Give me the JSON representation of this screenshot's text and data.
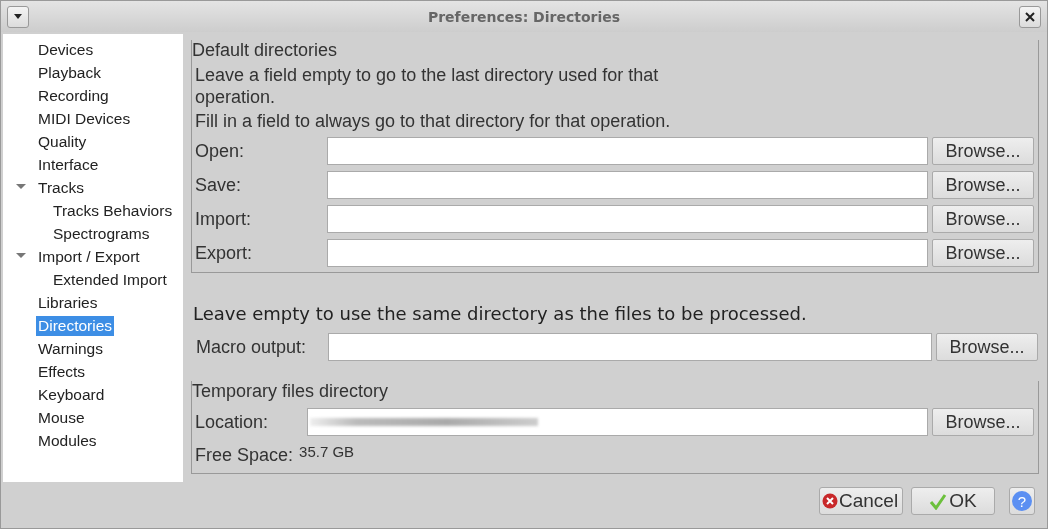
{
  "window": {
    "title": "Preferences: Directories"
  },
  "sidebar": {
    "items": [
      {
        "label": "Devices",
        "selected": false
      },
      {
        "label": "Playback",
        "selected": false
      },
      {
        "label": "Recording",
        "selected": false
      },
      {
        "label": "MIDI Devices",
        "selected": false
      },
      {
        "label": "Quality",
        "selected": false
      },
      {
        "label": "Interface",
        "selected": false
      },
      {
        "label": "Tracks",
        "selected": false,
        "expanded": true,
        "children": [
          {
            "label": "Tracks Behaviors",
            "selected": false
          },
          {
            "label": "Spectrograms",
            "selected": false
          }
        ]
      },
      {
        "label": "Import / Export",
        "selected": false,
        "expanded": true,
        "children": [
          {
            "label": "Extended Import",
            "selected": false
          }
        ]
      },
      {
        "label": "Libraries",
        "selected": false
      },
      {
        "label": "Directories",
        "selected": true
      },
      {
        "label": "Warnings",
        "selected": false
      },
      {
        "label": "Effects",
        "selected": false
      },
      {
        "label": "Keyboard",
        "selected": false
      },
      {
        "label": "Mouse",
        "selected": false
      },
      {
        "label": "Modules",
        "selected": false
      }
    ]
  },
  "default_directories": {
    "title": "Default directories",
    "notes": [
      "Leave a field empty to go to the last directory used for that operation.",
      "Fill in a field to always go to that directory for that operation."
    ],
    "fields": [
      {
        "label": "Open:",
        "button": "Browse..."
      },
      {
        "label": "Save:",
        "button": "Browse..."
      },
      {
        "label": "Import:",
        "button": "Browse..."
      },
      {
        "label": "Export:",
        "button": "Browse..."
      }
    ]
  },
  "macro": {
    "note": "Leave empty to use the same directory as the files to be processed.",
    "label": "Macro output:",
    "button": "Browse..."
  },
  "temporary": {
    "title": "Temporary files directory",
    "location_label": "Location:",
    "location_redacted": true,
    "button": "Browse...",
    "free_space_label": "Free Space:",
    "free_space": "35.7 GB"
  },
  "buttons": {
    "cancel": "Cancel",
    "ok": "OK",
    "help": "?"
  }
}
